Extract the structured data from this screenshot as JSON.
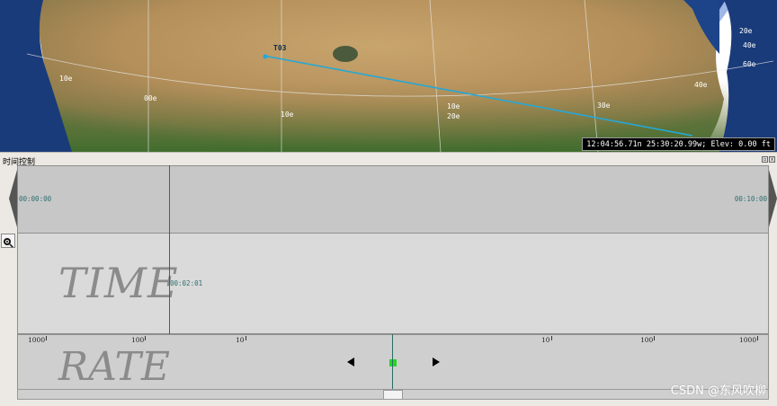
{
  "globe": {
    "object_label": "T03",
    "grid_labels": [
      "10e",
      "00e",
      "10e",
      "10e",
      "20e",
      "30e",
      "40e",
      "20e",
      "40e",
      "60e"
    ],
    "status_text": "12:04:56.71n 25:30:20.99w; Elev: 0.00 ft",
    "colors": {
      "track": "#23a8d8",
      "ocean": "#1a3b7a",
      "land": "#b6935d"
    }
  },
  "time_control": {
    "title": "时间控制",
    "window_buttons": [
      "▫",
      "x"
    ],
    "start_time": "00:00:00",
    "end_time": "00:10:00",
    "current_time": "00:02:01",
    "time_watermark": "TIME",
    "rate_watermark": "RATE",
    "rate_ticks": [
      "1000",
      "100",
      "10",
      "10",
      "100",
      "1000"
    ],
    "current_progress": 0.2017,
    "colors": {
      "cursor": "#2d6b66",
      "rate_indicator": "#22d822"
    }
  },
  "watermark": "CSDN @东风吹柳"
}
